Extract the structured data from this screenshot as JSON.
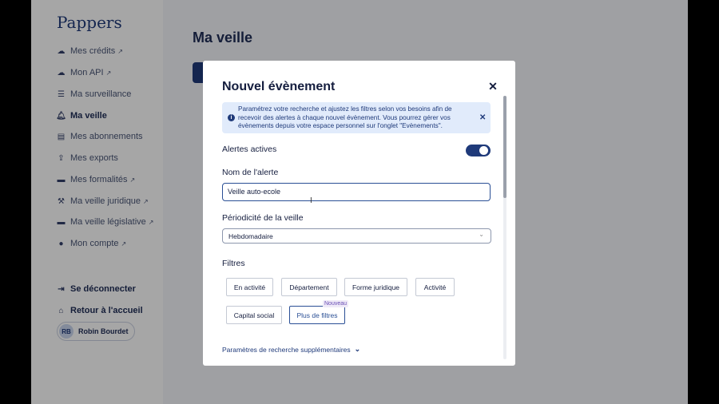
{
  "app": {
    "brand": "Pappers",
    "page_title": "Ma veille"
  },
  "sidebar": {
    "items": [
      {
        "label": "Mes crédits",
        "icon": "cloud-icon",
        "external": true
      },
      {
        "label": "Mon API",
        "icon": "cloud-icon",
        "external": true
      },
      {
        "label": "Ma surveillance",
        "icon": "list-icon",
        "external": false
      },
      {
        "label": "Ma veille",
        "icon": "bell-icon",
        "external": false,
        "active": true
      },
      {
        "label": "Mes abonnements",
        "icon": "document-icon",
        "external": false
      },
      {
        "label": "Mes exports",
        "icon": "export-icon",
        "external": false
      },
      {
        "label": "Mes formalités",
        "icon": "folder-icon",
        "external": true
      },
      {
        "label": "Ma veille juridique",
        "icon": "gavel-icon",
        "external": true
      },
      {
        "label": "Ma veille législative",
        "icon": "folder-icon",
        "external": true
      },
      {
        "label": "Mon compte",
        "icon": "user-icon",
        "external": true
      }
    ],
    "logout": "Se déconnecter",
    "home": "Retour à l'accueil",
    "user": {
      "initials": "RB",
      "name": "Robin Bourdet"
    }
  },
  "modal": {
    "title": "Nouvel évènement",
    "info_text": "Paramétrez votre recherche et ajustez les filtres selon vos besoins afin de recevoir des alertes à chaque nouvel évènement. Vous pourrez gérer vos évènements depuis votre espace personnel sur l'onglet \"Evènements\".",
    "alerts_label": "Alertes actives",
    "alerts_on": true,
    "name_label": "Nom de l'alerte",
    "name_value": "Veille auto-ecole",
    "periodicity_label": "Périodicité de la veille",
    "periodicity_value": "Hebdomadaire",
    "filters_label": "Filtres",
    "filters": [
      "En activité",
      "Département",
      "Forme juridique",
      "Activité",
      "Capital social",
      "Plus de filtres"
    ],
    "new_badge": "Nouveau",
    "more_params": "Paramètres de recherche supplémentaires"
  },
  "colors": {
    "accent": "#1f3a7a",
    "info_bg": "#e1ebfb"
  }
}
